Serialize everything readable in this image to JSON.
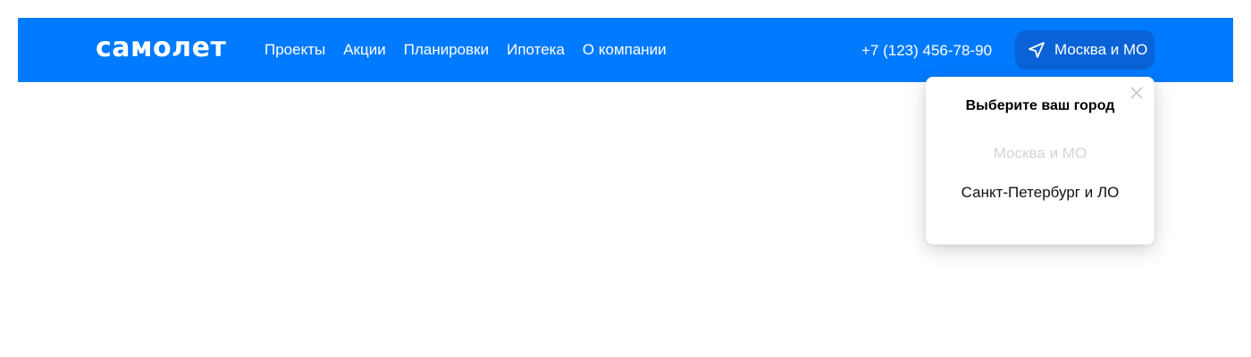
{
  "header": {
    "logo": "самолет",
    "nav": [
      "Проекты",
      "Акции",
      "Планировки",
      "Ипотека",
      "О компании"
    ],
    "phone": "+7 (123) 456-78-90",
    "city_button": {
      "label": "Москва и МО",
      "icon": "location-arrow-icon"
    }
  },
  "city_popup": {
    "title": "Выберите ваш город",
    "close_icon": "close-icon",
    "options": [
      {
        "label": "Москва и МО",
        "selected": true
      },
      {
        "label": "Санкт-Петербург и ЛО",
        "selected": false
      }
    ]
  },
  "colors": {
    "brand": "#007aff",
    "button_bg": "#0a63d6",
    "selected_option": "#d4d4d4"
  }
}
